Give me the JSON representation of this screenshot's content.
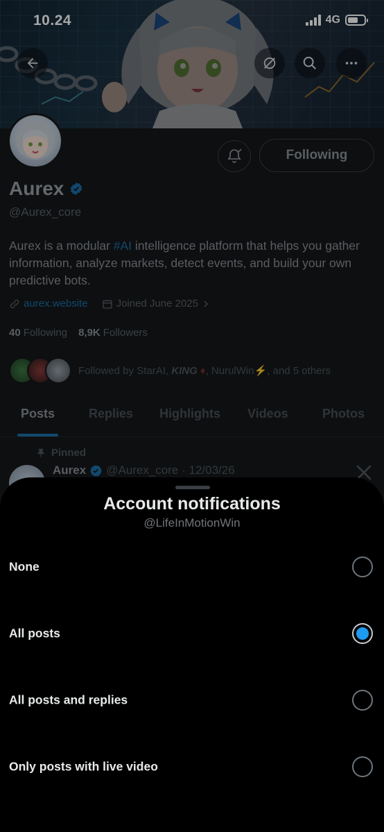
{
  "status_bar": {
    "time": "10.24",
    "network": "4G",
    "battery_level": 0.62
  },
  "profile": {
    "display_name": "Aurex",
    "handle": "@Aurex_core",
    "bio_before": "Aurex is a modular ",
    "bio_hashtag": "#AI",
    "bio_after": " intelligence platform that helps you gather information, analyze markets, detect events, and build your own predictive bots.",
    "website": "aurex.website",
    "joined": "Joined June 2025",
    "following_count": "40",
    "following_label": "Following",
    "followers_count": "8,9K",
    "followers_label": "Followers",
    "followed_by_prefix": "Followed by StarAI, ",
    "followed_by_king": "KING",
    "followed_by_middle": ", NurulWin",
    "followed_by_suffix": ", and 5 others",
    "following_button": "Following"
  },
  "tabs": [
    "Posts",
    "Replies",
    "Highlights",
    "Videos",
    "Photos"
  ],
  "active_tab": "Posts",
  "pinned_post": {
    "pinned_label": "Pinned",
    "author": "Aurex",
    "handle_date": "@Aurex_core · 12/03/26"
  },
  "sheet": {
    "title": "Account notifications",
    "subtitle": "@LifeInMotionWin",
    "options": [
      {
        "label": "None",
        "selected": false
      },
      {
        "label": "All posts",
        "selected": true
      },
      {
        "label": "All posts and replies",
        "selected": false
      },
      {
        "label": "Only posts with live video",
        "selected": false
      }
    ]
  },
  "colors": {
    "accent": "#1d9bf0",
    "background": "#000000",
    "verified": "#1d9bf0"
  }
}
